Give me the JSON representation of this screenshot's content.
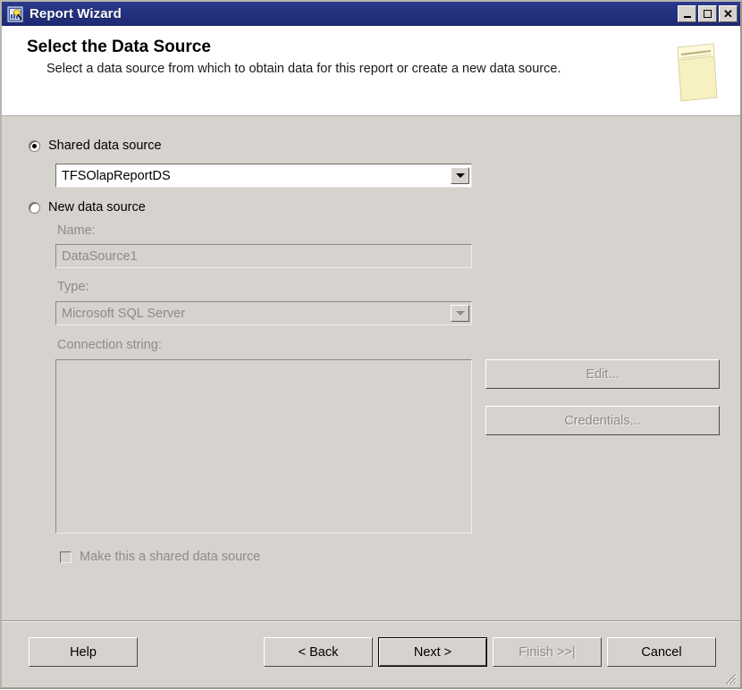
{
  "window": {
    "title": "Report Wizard",
    "title_icon": "report-wizard-icon",
    "controls": {
      "minimize": "Minimize",
      "maximize": "Maximize",
      "close": "Close"
    }
  },
  "header": {
    "title": "Select the Data Source",
    "subtitle": "Select a data source from which to obtain data for this report or create a new data source.",
    "icon": "data-source-folder-icon"
  },
  "form": {
    "shared": {
      "radio_label": "Shared data source",
      "selected": true,
      "combo_value": "TFSOlapReportDS",
      "combo_arrow_icon": "chevron-down-icon"
    },
    "new_source": {
      "radio_label": "New data source",
      "selected": false,
      "name_label": "Name:",
      "name_value": "DataSource1",
      "type_label": "Type:",
      "type_value": "Microsoft SQL Server",
      "type_arrow_icon": "chevron-down-icon",
      "connection_label": "Connection string:",
      "connection_value": "",
      "edit_button": "Edit...",
      "credentials_button": "Credentials...",
      "make_shared_label": "Make this a shared data source",
      "make_shared_checked": false
    }
  },
  "footer": {
    "help": "Help",
    "back": "< Back",
    "next": "Next >",
    "finish": "Finish >>|",
    "cancel": "Cancel",
    "resize_grip_icon": "resize-grip-icon"
  },
  "colors": {
    "titlebar": "#23307d",
    "face": "#d6d3ce",
    "banner": "#ffffff",
    "disabled_text": "#8e8b86",
    "icon_paper": "#f5efc0"
  }
}
